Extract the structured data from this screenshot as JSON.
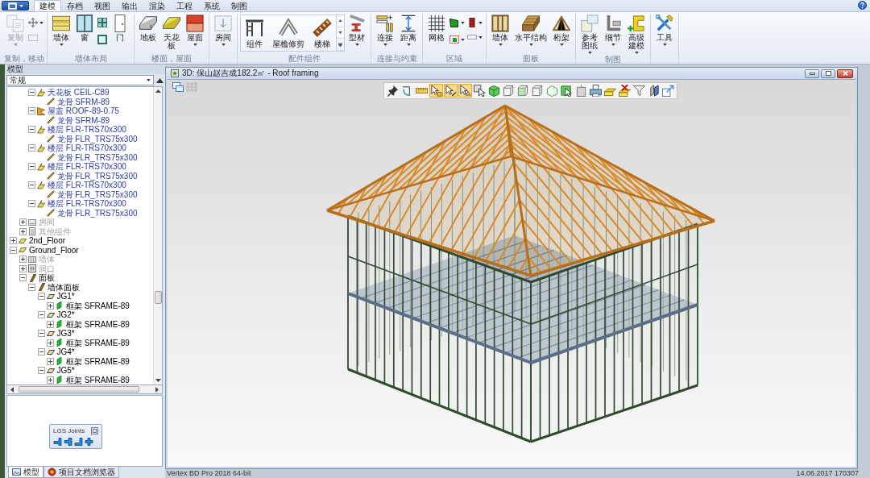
{
  "ribbon": {
    "tabs": [
      {
        "label": "建模",
        "selected": true
      },
      {
        "label": "存档",
        "selected": false
      },
      {
        "label": "视图",
        "selected": false
      },
      {
        "label": "输出",
        "selected": false
      },
      {
        "label": "渲染",
        "selected": false
      },
      {
        "label": "工程",
        "selected": false
      },
      {
        "label": "系统",
        "selected": false
      },
      {
        "label": "制图",
        "selected": false
      }
    ],
    "groups": [
      {
        "label": "复制，移动",
        "items": [
          {
            "kind": "large",
            "label": "复制",
            "disabled": true,
            "dropdown": true
          },
          {
            "kind": "small",
            "disabled": false,
            "dropdown": true
          },
          {
            "kind": "small",
            "disabled": true,
            "dropdown": false
          }
        ]
      },
      {
        "label": "墙体布局",
        "items": [
          {
            "kind": "large",
            "label": "墙体",
            "disabled": false,
            "dropdown": true
          },
          {
            "kind": "large",
            "label": "窗",
            "disabled": false,
            "dropdown": false
          },
          {
            "kind": "small",
            "disabled": false,
            "dropdown": false
          },
          {
            "kind": "small",
            "disabled": false,
            "dropdown": false
          },
          {
            "kind": "large",
            "label": "门",
            "disabled": false,
            "dropdown": false
          }
        ]
      },
      {
        "label": "楼面，屋面",
        "items": [
          {
            "kind": "large",
            "label": "地板",
            "disabled": false,
            "dropdown": false
          },
          {
            "kind": "large",
            "label": "天花板",
            "disabled": false,
            "dropdown": false
          },
          {
            "kind": "large",
            "label": "屋面",
            "disabled": false,
            "dropdown": true
          }
        ]
      },
      {
        "items": [
          {
            "kind": "large",
            "label": "房间",
            "disabled": false,
            "dropdown": true
          }
        ]
      },
      {
        "label": "配件组件",
        "items": [
          {
            "kind": "gallery",
            "label": "组件",
            "disabled": false,
            "dropdown": false
          },
          {
            "kind": "gallery",
            "label": "屋檐修剪",
            "disabled": false,
            "dropdown": false
          },
          {
            "kind": "gallery",
            "label": "楼梯",
            "disabled": false,
            "dropdown": false
          },
          {
            "kind": "large",
            "label": "型材",
            "disabled": false,
            "dropdown": true
          }
        ]
      },
      {
        "label": "连接与约束",
        "items": [
          {
            "kind": "large",
            "label": "连接",
            "disabled": false,
            "dropdown": true
          },
          {
            "kind": "large",
            "label": "距离",
            "disabled": false,
            "dropdown": true
          }
        ]
      },
      {
        "label": "区域",
        "items": [
          {
            "kind": "large",
            "label": "网格",
            "disabled": false,
            "dropdown": false
          },
          {
            "kind": "small",
            "disabled": false,
            "dropdown": true
          },
          {
            "kind": "small",
            "disabled": false,
            "dropdown": true
          },
          {
            "kind": "small",
            "disabled": false,
            "dropdown": true
          },
          {
            "kind": "small",
            "disabled": false,
            "dropdown": true
          }
        ]
      },
      {
        "label": "面板",
        "items": [
          {
            "kind": "large",
            "label": "墙体",
            "disabled": false,
            "dropdown": true
          },
          {
            "kind": "large",
            "label": "水平结构",
            "disabled": false,
            "dropdown": true
          },
          {
            "kind": "large",
            "label": "桁架",
            "disabled": false,
            "dropdown": true
          }
        ]
      },
      {
        "label": "制图",
        "items": [
          {
            "kind": "large",
            "label": "参考图纸",
            "disabled": false,
            "dropdown": true
          },
          {
            "kind": "large",
            "label": "细节",
            "disabled": false,
            "dropdown": true
          },
          {
            "kind": "large",
            "label": "高级建模",
            "disabled": false,
            "dropdown": true
          }
        ]
      },
      {
        "items": [
          {
            "kind": "large",
            "label": "工具",
            "disabled": false,
            "dropdown": true
          }
        ]
      }
    ]
  },
  "model_panel": {
    "title": "模型",
    "filter": {
      "value": "常规"
    },
    "tree": [
      {
        "children": [
          {
            "children": [
              {
                "label": "天花板 CEIL-C89",
                "kind": "slab",
                "expanded": true,
                "disabled": false,
                "color": "#2a3c9e",
                "children": [
                  {
                    "label": "龙骨 SFRM-89",
                    "kind": "stick",
                    "disabled": false,
                    "color": "#2a3c9e"
                  }
                ]
              },
              {
                "label": "屋盖 ROOF-89-0.75",
                "kind": "wedge",
                "expanded": true,
                "disabled": false,
                "color": "#2a3c9e",
                "children": [
                  {
                    "label": "龙骨 SFRM-89",
                    "kind": "stick",
                    "disabled": false,
                    "color": "#2a3c9e"
                  }
                ]
              },
              {
                "label": "楼层 FLR-TRS70x300",
                "kind": "slab",
                "expanded": true,
                "disabled": false,
                "color": "#2a3c9e",
                "children": [
                  {
                    "label": "龙骨 FLR_TRS75x300",
                    "kind": "stick",
                    "disabled": false,
                    "color": "#2a3c9e"
                  }
                ]
              },
              {
                "label": "楼层 FLR-TRS70x300",
                "kind": "slab",
                "expanded": true,
                "disabled": false,
                "color": "#2a3c9e",
                "children": [
                  {
                    "label": "龙骨 FLR_TRS75x300",
                    "kind": "stick",
                    "disabled": false,
                    "color": "#2a3c9e"
                  }
                ]
              },
              {
                "label": "楼层 FLR-TRS70x300",
                "kind": "slab",
                "expanded": true,
                "disabled": false,
                "color": "#2a3c9e",
                "children": [
                  {
                    "label": "龙骨 FLR_TRS75x300",
                    "kind": "stick",
                    "disabled": false,
                    "color": "#2a3c9e"
                  }
                ]
              },
              {
                "label": "楼层 FLR-TRS70x300",
                "kind": "slab",
                "expanded": true,
                "disabled": false,
                "color": "#2a3c9e",
                "children": [
                  {
                    "label": "龙骨 FLR_TRS75x300",
                    "kind": "stick",
                    "disabled": false,
                    "color": "#2a3c9e"
                  }
                ]
              },
              {
                "label": "楼层 FLR-TRS70x300",
                "kind": "slab",
                "expanded": true,
                "disabled": false,
                "color": "#2a3c9e",
                "children": [
                  {
                    "label": "龙骨 FLR_TRS75x300",
                    "kind": "stick",
                    "disabled": false,
                    "color": "#2a3c9e"
                  }
                ]
              }
            ]
          },
          {
            "label": "房间",
            "kind": "room",
            "expanded": false,
            "disabled": true
          },
          {
            "label": "其他组件",
            "kind": "document",
            "expanded": false,
            "disabled": true
          }
        ]
      },
      {
        "label": "2nd_Floor",
        "kind": "level",
        "expanded": false,
        "disabled": false
      },
      {
        "label": "Ground_Floor",
        "kind": "level",
        "expanded": true,
        "disabled": false,
        "children": [
          {
            "label": "墙体",
            "kind": "wall",
            "expanded": false,
            "disabled": true
          },
          {
            "label": "洞口",
            "kind": "opening",
            "expanded": false,
            "disabled": true
          },
          {
            "label": "面板",
            "kind": "beam",
            "expanded": true,
            "disabled": false,
            "children": [
              {
                "label": "墙体面板",
                "kind": "beam",
                "expanded": true,
                "disabled": false,
                "children": [
                  {
                    "label": "JG1*",
                    "kind": "plate",
                    "expanded": true,
                    "disabled": false,
                    "children": [
                      {
                        "label": "框架 SFRAME-89",
                        "kind": "frame",
                        "expanded": false,
                        "disabled": false
                      }
                    ]
                  },
                  {
                    "label": "JG2*",
                    "kind": "plate",
                    "expanded": true,
                    "disabled": false,
                    "children": [
                      {
                        "label": "框架 SFRAME-89",
                        "kind": "frame",
                        "expanded": false,
                        "disabled": false
                      }
                    ]
                  },
                  {
                    "label": "JG3*",
                    "kind": "plate",
                    "expanded": true,
                    "disabled": false,
                    "children": [
                      {
                        "label": "框架 SFRAME-89",
                        "kind": "frame",
                        "expanded": false,
                        "disabled": false
                      }
                    ]
                  },
                  {
                    "label": "JG4*",
                    "kind": "plate",
                    "expanded": true,
                    "disabled": false,
                    "children": [
                      {
                        "label": "框架 SFRAME-89",
                        "kind": "frame",
                        "expanded": false,
                        "disabled": false
                      }
                    ]
                  },
                  {
                    "label": "JG5*",
                    "kind": "plate",
                    "expanded": true,
                    "disabled": false,
                    "children": [
                      {
                        "label": "框架 SFRAME-89",
                        "kind": "frame",
                        "expanded": false,
                        "disabled": false
                      }
                    ]
                  }
                ]
              }
            ]
          }
        ]
      }
    ],
    "joints_toolbar": {
      "title": "LGS Joints"
    },
    "tabs": [
      {
        "label": "模型",
        "selected": true
      },
      {
        "label": "项目文档浏览器",
        "selected": false
      }
    ]
  },
  "viewport_window": {
    "title": "3D: 保山赵吉成182.2㎡ - Roof framing",
    "toolbar": [
      {
        "selected": false
      },
      {
        "selected": false
      },
      {
        "selected": false
      },
      {
        "selected": true
      },
      {
        "selected": true
      },
      {
        "selected": true
      },
      {
        "selected": false
      },
      {
        "selected": false
      },
      {
        "selected": false
      },
      {
        "selected": false
      },
      {
        "selected": false
      },
      {
        "selected": false
      },
      {
        "selected": false
      },
      {
        "selected": false
      },
      {
        "selected": false
      },
      {
        "selected": false
      },
      {
        "selected": false
      },
      {
        "selected": false
      },
      {
        "selected": false
      },
      {
        "selected": false
      }
    ]
  },
  "status_bar": {
    "product": "Vertex BD Pro 2018 64-bit",
    "timestamp": "14.06.2017 170307"
  }
}
